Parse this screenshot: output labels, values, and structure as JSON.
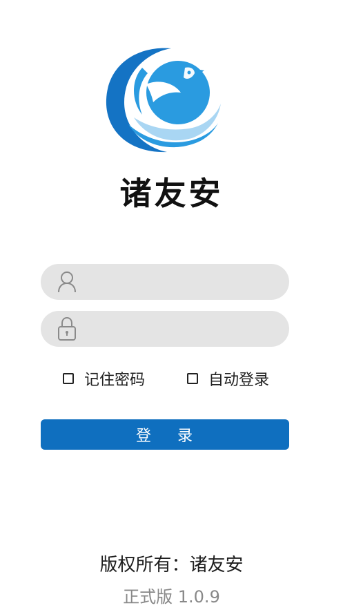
{
  "app": {
    "brand_name": "诸友安"
  },
  "login_form": {
    "username_placeholder": "",
    "password_placeholder": "",
    "remember_password_label": "记住密码",
    "auto_login_label": "自动登录",
    "remember_password_checked": false,
    "auto_login_checked": false,
    "login_button_label": "登    录"
  },
  "footer": {
    "copyright": "版权所有：诸友安",
    "version": "正式版 1.0.9"
  },
  "icons": {
    "logo": "bird-globe-logo",
    "username": "person-icon",
    "password": "lock-icon"
  },
  "colors": {
    "primary": "#0f6fbf",
    "field_bg": "#e4e4e4",
    "logo_dark": "#1473c4",
    "logo_mid": "#2a9be0",
    "logo_light": "#a9d6f3"
  }
}
